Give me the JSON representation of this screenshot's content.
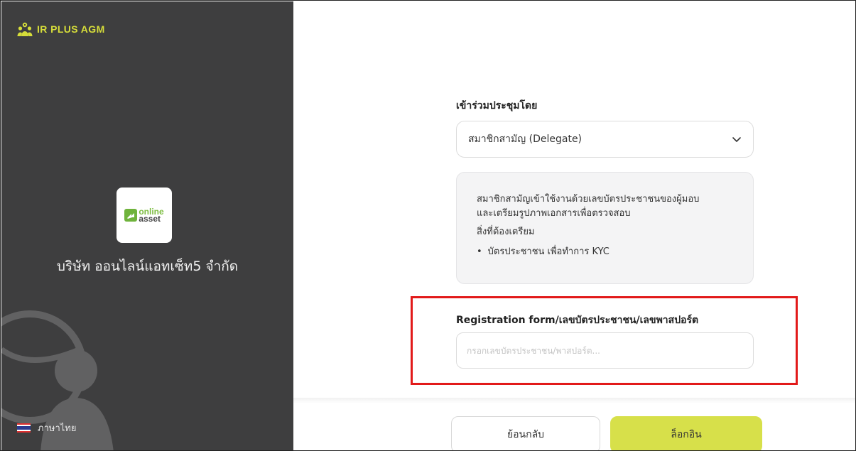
{
  "sidebar": {
    "brand": "IR PLUS AGM",
    "logo_words": [
      "online",
      "asset"
    ],
    "company_name": "บริษัท ออนไลน์แอทเซ็ท5 จำกัด",
    "language": "ภาษาไทย"
  },
  "form": {
    "attend_label": "เข้าร่วมประชุมโดย",
    "attend_selected": "สมาชิกสามัญ (Delegate)",
    "info": {
      "line1": "สมาชิกสามัญเข้าใช้งานด้วยเลขบัตรประชาชนของผู้มอบ",
      "line2": "และเตรียมรูปภาพเอกสารเพื่อตรวจสอบ",
      "line3": "สิ่งที่ต้องเตรียม",
      "bullet": "บัตรประชาชน เพื่อทำการ KYC"
    },
    "reg_label": "Registration form/เลขบัตรประชาชน/เลขพาสปอร์ต",
    "reg_placeholder": "กรอกเลขบัตรประชาชน/พาสปอร์ต...",
    "reg_value": ""
  },
  "actions": {
    "back": "ย้อนกลับ",
    "login": "ล็อกอิน"
  },
  "colors": {
    "sidebar_bg": "#3e3e3f",
    "accent": "#d7e04a",
    "highlight": "#e21a1a"
  }
}
